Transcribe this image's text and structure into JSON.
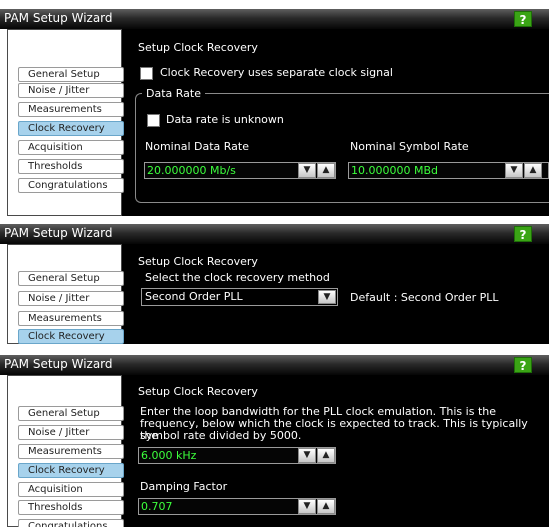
{
  "colors": {
    "titlebar": "#1a1a1a",
    "help": "#3aa415",
    "nav_selected": "#a7d2ec",
    "value_text": "#3cff3c"
  },
  "panel1": {
    "title": "PAM Setup Wizard",
    "help": "?",
    "nav": [
      "General Setup",
      "Noise / Jitter",
      "Measurements",
      "Clock Recovery",
      "Acquisition",
      "Thresholds",
      "Congratulations"
    ],
    "heading": "Setup Clock Recovery",
    "separate_clock_label": "Clock Recovery uses separate clock signal",
    "data_rate_group": "Data Rate",
    "data_rate_unknown_label": "Data rate is unknown",
    "nominal_data_rate_label": "Nominal Data Rate",
    "nominal_data_rate_value": "20.000000 Mb/s",
    "nominal_symbol_rate_label": "Nominal Symbol Rate",
    "nominal_symbol_rate_value": "10.000000 MBd"
  },
  "panel2": {
    "title": "PAM Setup Wizard",
    "help": "?",
    "nav": [
      "General Setup",
      "Noise / Jitter",
      "Measurements",
      "Clock Recovery"
    ],
    "heading": "Setup Clock Recovery",
    "select_label": "Select the clock recovery method",
    "method_value": "Second Order PLL",
    "default_text": "Default :  Second Order PLL"
  },
  "panel3": {
    "title": "PAM Setup Wizard",
    "help": "?",
    "nav": [
      "General Setup",
      "Noise / Jitter",
      "Measurements",
      "Clock Recovery",
      "Acquisition",
      "Thresholds",
      "Congratulations"
    ],
    "heading": "Setup Clock Recovery",
    "para_lines": [
      "Enter the loop bandwidth for the PLL clock emulation. This is the",
      "frequency, below which the clock is expected to track. This is typically the",
      "symbol rate divided by 5000."
    ],
    "bandwidth_value": "6.000 kHz",
    "damping_label": "Damping Factor",
    "damping_value": "0.707"
  }
}
